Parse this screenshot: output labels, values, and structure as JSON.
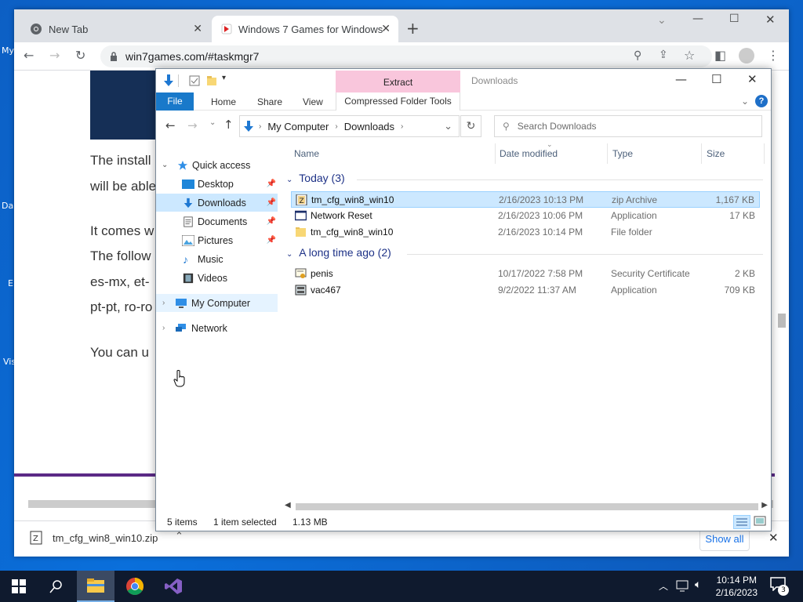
{
  "desktop": {
    "labels": [
      "My",
      "Da",
      "E",
      "Vis"
    ]
  },
  "browser": {
    "tabs": [
      {
        "title": "New Tab",
        "close": "✕"
      },
      {
        "title": "Windows 7 Games for Windows",
        "close": "✕"
      }
    ],
    "new_tab": "+",
    "url": "win7games.com/#taskmgr7",
    "page_lines": [
      "The install",
      "will be able",
      "It comes w",
      "The follow",
      "es-mx, et-",
      "pt-pt, ro-ro",
      "You can u"
    ],
    "download": {
      "filename": "tm_cfg_win8_win10.zip",
      "show_all": "Show all",
      "close": "✕"
    }
  },
  "explorer": {
    "title": "Downloads",
    "context_tab": "Extract",
    "ribbon": {
      "file": "File",
      "tabs": [
        "Home",
        "Share",
        "View"
      ],
      "contextual": "Compressed Folder Tools"
    },
    "breadcrumb": [
      "My Computer",
      "Downloads"
    ],
    "search_placeholder": "Search Downloads",
    "nav": {
      "quick_access": "Quick access",
      "items": [
        "Desktop",
        "Downloads",
        "Documents",
        "Pictures",
        "Music",
        "Videos"
      ],
      "my_computer": "My Computer",
      "network": "Network"
    },
    "columns": [
      "Name",
      "Date modified",
      "Type",
      "Size"
    ],
    "groups": [
      {
        "label": "Today (3)",
        "rows": [
          {
            "name": "tm_cfg_win8_win10",
            "date": "2/16/2023 10:13 PM",
            "type": "zip Archive",
            "size": "1,167 KB"
          },
          {
            "name": "Network Reset",
            "date": "2/16/2023 10:06 PM",
            "type": "Application",
            "size": "17 KB"
          },
          {
            "name": "tm_cfg_win8_win10",
            "date": "2/16/2023 10:14 PM",
            "type": "File folder",
            "size": ""
          }
        ]
      },
      {
        "label": "A long time ago (2)",
        "rows": [
          {
            "name": "penis",
            "date": "10/17/2022 7:58 PM",
            "type": "Security Certificate",
            "size": "2 KB"
          },
          {
            "name": "vac467",
            "date": "9/2/2022 11:37 AM",
            "type": "Application",
            "size": "709 KB"
          }
        ]
      }
    ],
    "status": {
      "items": "5 items",
      "selected": "1 item selected",
      "size": "1.13 MB"
    }
  },
  "taskbar": {
    "time": "10:14 PM",
    "date": "2/16/2023",
    "notification_count": "3"
  }
}
